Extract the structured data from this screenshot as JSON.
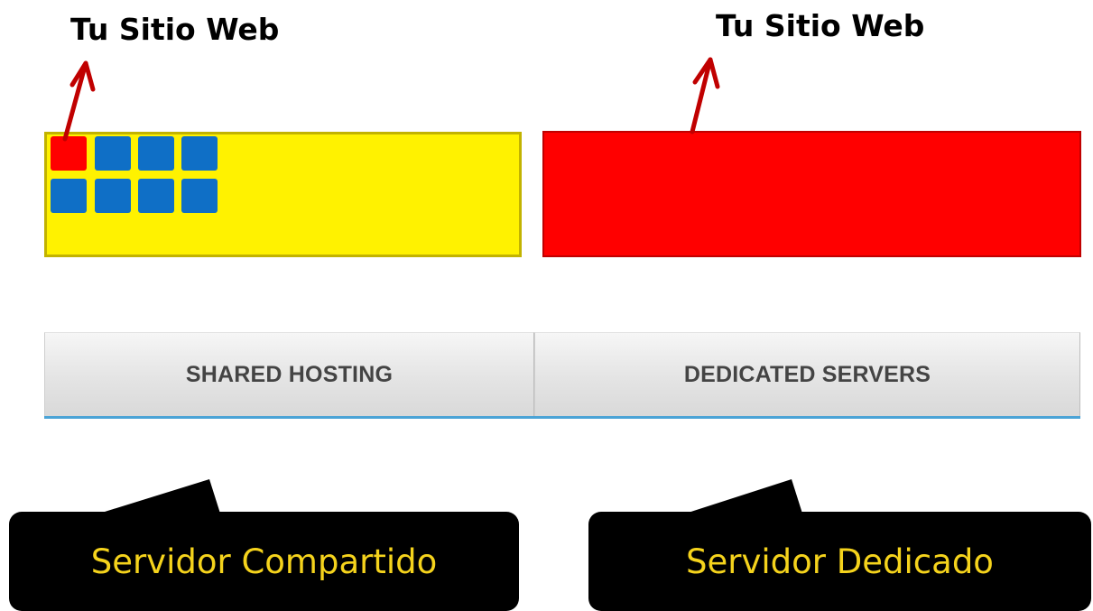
{
  "top_labels": {
    "left": "Tu Sitio Web",
    "right": "Tu Sitio Web"
  },
  "shared_hosting_box": {
    "color": "#fff200",
    "site_rows": 2,
    "sites_per_row": 4,
    "highlighted_site": "first",
    "highlight_color": "#ff0000",
    "other_sites_color": "#0f6fc6"
  },
  "dedicated_server_box": {
    "color": "#ff0000"
  },
  "tabs": [
    {
      "label": "SHARED HOSTING"
    },
    {
      "label": "DEDICATED SERVERS"
    }
  ],
  "callouts": {
    "shared": "Servidor Compartido",
    "dedicated": "Servidor Dedicado",
    "text_color": "#f5d31c",
    "background": "#000000"
  },
  "arrow_color": "#c00000"
}
